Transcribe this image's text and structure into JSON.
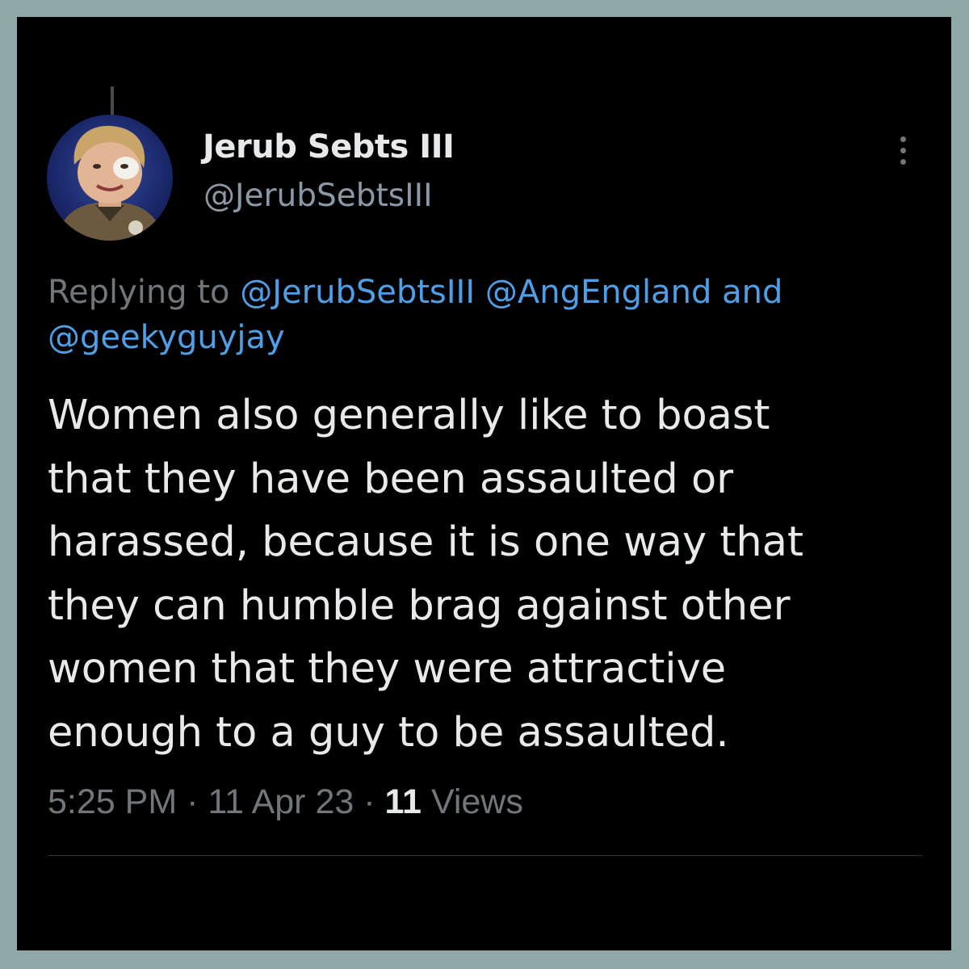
{
  "tweet": {
    "author_name": "Jerub Sebts III",
    "author_handle": "@JerubSebtsIII",
    "reply_prefix": "Replying to",
    "reply_mentions": [
      "@JerubSebtsIII",
      "@AngEngland",
      "@geekyguyjay"
    ],
    "reply_conjunction": "and",
    "text_lines": [
      "Women also generally like to boast",
      "that they have been assaulted or",
      "harassed, because it is one way that",
      "they can humble brag against other",
      "women that they were attractive",
      "enough to a guy to be assaulted."
    ],
    "time": "5:25 PM",
    "date": "11 Apr 23",
    "separator": "·",
    "views_count": "11",
    "views_label": "Views"
  },
  "icons": {
    "more": "more-vertical-icon"
  },
  "colors": {
    "border": "#8ea8a7",
    "background": "#000000",
    "text_primary": "#e7e9ea",
    "text_secondary": "#71767b",
    "mention_blue": "#4f9fe6"
  }
}
